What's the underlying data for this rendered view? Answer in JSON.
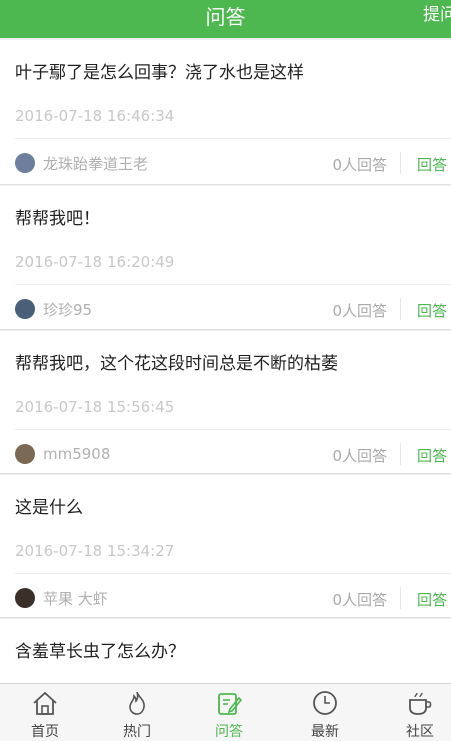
{
  "header": {
    "title": "问答",
    "ask_label": "提问"
  },
  "questions": [
    {
      "title": "叶子鄢了是怎么回事？浇了水也是这样",
      "time": "2016-07-18 16:46:34",
      "author": "龙珠跆拳道王老",
      "answers": "0人回答",
      "answer_label": "回答",
      "avatar_color": "#6d7f9c"
    },
    {
      "title": "帮帮我吧！",
      "time": "2016-07-18 16:20:49",
      "author": "珍珍95",
      "answers": "0人回答",
      "answer_label": "回答",
      "avatar_color": "#4a5f78"
    },
    {
      "title": "帮帮我吧，这个花这段时间总是不断的枯萎",
      "time": "2016-07-18 15:56:45",
      "author": "mm5908",
      "answers": "0人回答",
      "answer_label": "回答",
      "avatar_color": "#7a6a55"
    },
    {
      "title": "这是什么",
      "time": "2016-07-18 15:34:27",
      "author": "苹果 大虾",
      "answers": "0人回答",
      "answer_label": "回答",
      "avatar_color": "#3b2f2a"
    },
    {
      "title": "含羞草长虫了怎么办？"
    }
  ],
  "tabs": [
    {
      "label": "首页",
      "icon": "home-icon"
    },
    {
      "label": "热门",
      "icon": "flame-icon"
    },
    {
      "label": "问答",
      "icon": "edit-icon",
      "active": true
    },
    {
      "label": "最新",
      "icon": "clock-icon"
    },
    {
      "label": "社区",
      "icon": "cup-icon"
    }
  ],
  "colors": {
    "accent": "#4cb84f",
    "background": "#eeeeee"
  }
}
